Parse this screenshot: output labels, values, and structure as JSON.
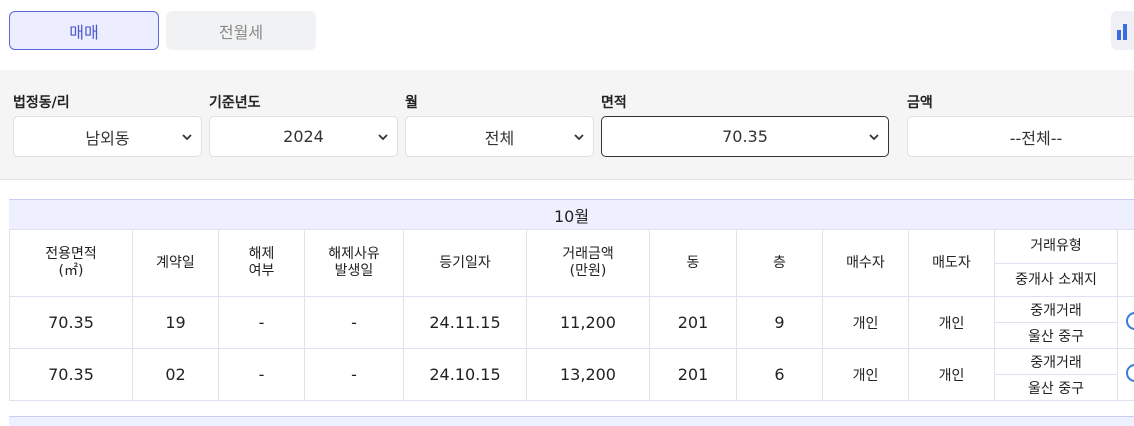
{
  "tabs": {
    "sale": "매매",
    "rent": "전월세"
  },
  "filters": {
    "dong_label": "법정동/리",
    "dong_value": "남외동",
    "year_label": "기준년도",
    "year_value": "2024",
    "month_label": "월",
    "month_value": "전체",
    "area_label": "면적",
    "area_value": "70.35",
    "price_label": "금액",
    "price_value": "--전체--"
  },
  "month_section": "10월",
  "columns": {
    "area": "전용면적\n(㎡)",
    "contract_day": "계약일",
    "cancel": "해제\n여부",
    "cancel_reason": "해제사유\n발생일",
    "reg_date": "등기일자",
    "price": "거래금액\n(만원)",
    "building": "동",
    "floor": "층",
    "buyer": "매수자",
    "seller": "매도자",
    "deal_type": "거래유형",
    "agent_location": "중개사 소재지"
  },
  "rows": [
    {
      "area": "70.35",
      "day": "19",
      "cancel": "-",
      "cancel_reason": "-",
      "reg_date": "24.11.15",
      "price": "11,200",
      "building": "201",
      "floor": "9",
      "buyer": "개인",
      "seller": "개인",
      "deal_type": "중개거래",
      "agent_location": "울산 중구"
    },
    {
      "area": "70.35",
      "day": "02",
      "cancel": "-",
      "cancel_reason": "-",
      "reg_date": "24.10.15",
      "price": "13,200",
      "building": "201",
      "floor": "6",
      "buyer": "개인",
      "seller": "개인",
      "deal_type": "중개거래",
      "agent_location": "울산 중구"
    }
  ],
  "icons": {
    "chevron": "chevron-down-icon",
    "chart": "bar-chart-icon",
    "detail": "circle-icon"
  }
}
